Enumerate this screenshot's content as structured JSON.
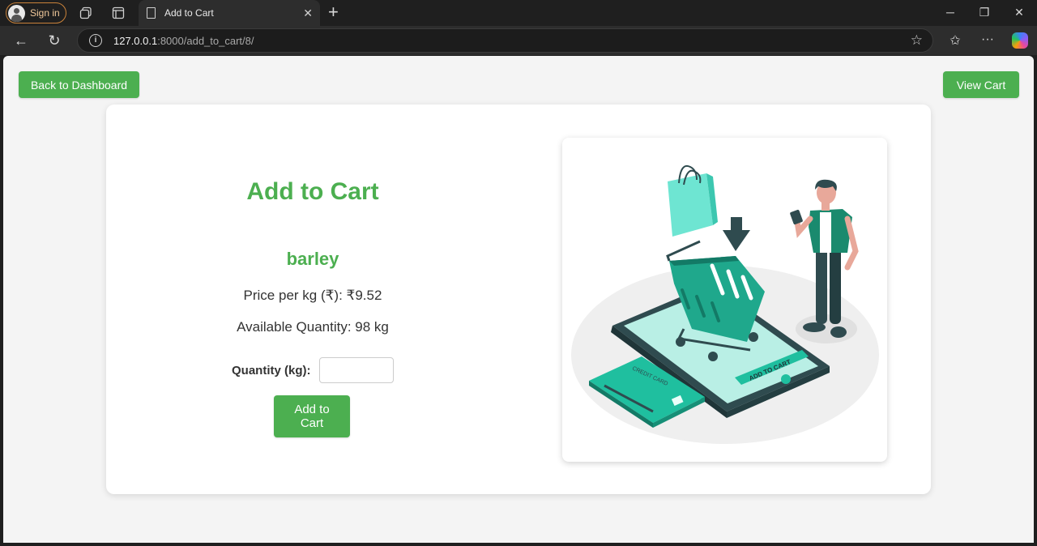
{
  "browser": {
    "signin_label": "Sign in",
    "tab_title": "Add to Cart",
    "url_host": "127.0.0.1",
    "url_rest": ":8000/add_to_cart/8/"
  },
  "header": {
    "back_label": "Back to Dashboard",
    "view_cart_label": "View Cart"
  },
  "form": {
    "title": "Add to Cart",
    "product_name": "barley",
    "price_line": "Price per kg (₹): ₹9.52",
    "availability_line": "Available Quantity: 98 kg",
    "quantity_label": "Quantity (kg):",
    "quantity_value": "",
    "submit_label": "Add to Cart"
  },
  "illustration": {
    "credit_card_text": "CREDIT CARD",
    "add_to_cart_text": "ADD TO CART"
  },
  "colors": {
    "accent": "#4caf50",
    "teal": "#1fbf9f"
  }
}
